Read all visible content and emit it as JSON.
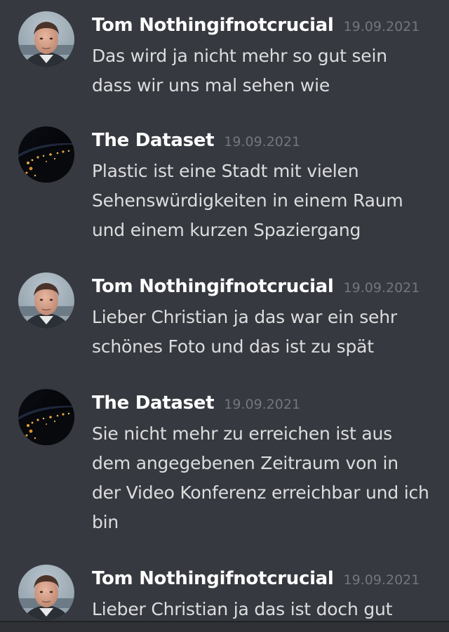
{
  "messages": [
    {
      "author": "Tom Nothingifnotcrucial",
      "timestamp": "19.09.2021",
      "avatar": "man-portrait-avatar",
      "text": "Das wird ja nicht mehr so gut sein dass wir uns mal sehen wie"
    },
    {
      "author": "The Dataset",
      "timestamp": "19.09.2021",
      "avatar": "earth-at-night-avatar",
      "text": "Plastic ist eine Stadt mit vielen Sehenswürdigkeiten in einem Raum und einem kurzen Spaziergang"
    },
    {
      "author": "Tom Nothingifnotcrucial",
      "timestamp": "19.09.2021",
      "avatar": "man-portrait-avatar",
      "text": "Lieber Christian ja das war ein sehr schönes Foto und das ist zu spät"
    },
    {
      "author": "The Dataset",
      "timestamp": "19.09.2021",
      "avatar": "earth-at-night-avatar",
      "text": "Sie nicht mehr zu erreichen ist aus dem angegebenen Zeitraum von in der Video Konferenz erreichbar und ich bin"
    },
    {
      "author": "Tom Nothingifnotcrucial",
      "timestamp": "19.09.2021",
      "avatar": "man-portrait-avatar",
      "text": "Lieber Christian ja das ist doch gut"
    }
  ],
  "colors": {
    "background": "#36393f",
    "author": "#ffffff",
    "timestamp": "#72767d",
    "message_text": "#dcddde"
  }
}
